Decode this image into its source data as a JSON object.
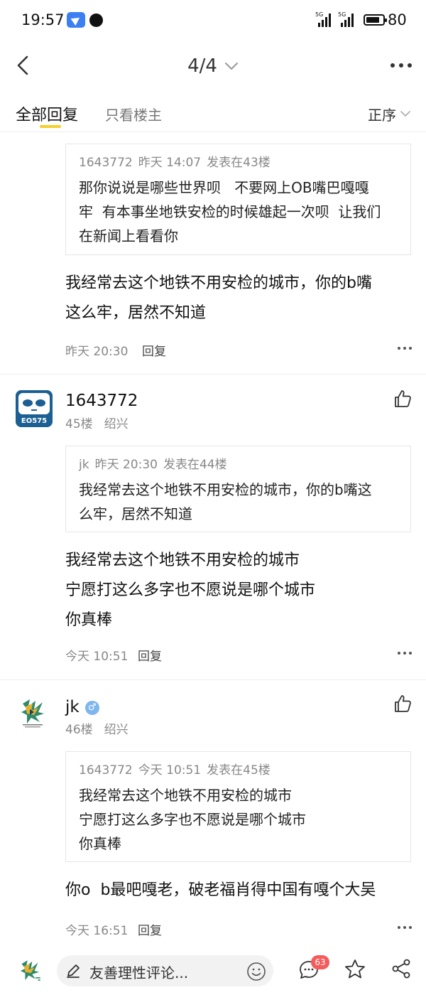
{
  "status_bar": {
    "time": "19:57",
    "battery": "80",
    "battery_fraction": 0.8,
    "network_tags": [
      "5G",
      "5G"
    ]
  },
  "nav": {
    "page_indicator": "4/4"
  },
  "tabs": {
    "all_replies": "全部回复",
    "only_owner": "只看楼主",
    "sort": "正序"
  },
  "posts": [
    {
      "quote": {
        "user": "1643772",
        "date": "昨天 14:07",
        "floor": "发表在43楼",
        "text": "那你说说是哪些世界呗   不要网上OB嘴巴嘎嘎\n牢  有本事坐地铁安检的时候雄起一次呗  让我们\n在新闻上看看你"
      },
      "body": "我经常去这个地铁不用安检的城市，你的b嘴\n这么牢，居然不知道",
      "time": "昨天 20:30",
      "reply": "回复"
    },
    {
      "username": "1643772",
      "floor": "45楼",
      "location": "绍兴",
      "avatar_text": "EO575",
      "quote": {
        "user": "jk",
        "date": "昨天 20:30",
        "floor": "发表在44楼",
        "text": "我经常去这个地铁不用安检的城市，你的b嘴这\n么牢，居然不知道"
      },
      "body": "我经常去这个地铁不用安检的城市\n宁愿打这么多字也不愿说是哪个城市\n你真棒",
      "time": "今天 10:51",
      "reply": "回复"
    },
    {
      "username": "jk",
      "gender": "♂",
      "floor": "46楼",
      "location": "绍兴",
      "quote": {
        "user": "1643772",
        "date": "今天 10:51",
        "floor": "发表在45楼",
        "text": "我经常去这个地铁不用安检的城市\n宁愿打这么多字也不愿说是哪个城市\n你真棒"
      },
      "body": "你o  b最吧嘎老，破老福肖得中国有嘎个大吴",
      "time": "今天 16:51",
      "reply": "回复"
    }
  ],
  "bottom_bar": {
    "placeholder": "友善理性评论...",
    "comment_count": "63"
  },
  "icons": {
    "back": "back-icon",
    "dropdown": "chevron-down-icon",
    "more": "more-icon",
    "like": "thumbs-up-icon",
    "edit": "pen-icon",
    "emoji": "smile-icon",
    "comments": "comment-icon",
    "favorite": "star-icon",
    "share": "share-icon"
  },
  "colors": {
    "tab_underline": "#f5cf2a",
    "badge": "#f55b5b",
    "status_app": "#3b7ff3",
    "avatar_blue": "#1b5f93",
    "gender": "#7fb6ee"
  }
}
